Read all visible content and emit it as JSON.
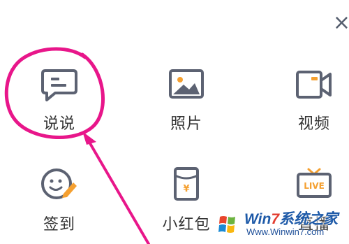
{
  "close_glyph": "×",
  "actions": [
    {
      "label": "说说",
      "icon": "message-icon"
    },
    {
      "label": "照片",
      "icon": "photo-icon"
    },
    {
      "label": "视频",
      "icon": "video-camera-icon"
    },
    {
      "label": "签到",
      "icon": "check-in-face-icon"
    },
    {
      "label": "小红包",
      "icon": "red-packet-icon"
    },
    {
      "label": "直播",
      "icon": "live-tv-icon"
    }
  ],
  "watermark": {
    "title_part1": "Win",
    "title_num": "7",
    "title_part2": "系统之家",
    "url": "Www.Winwin7.com"
  },
  "colors": {
    "icon_gray": "#5c6272",
    "accent_orange": "#f5a030",
    "annotation_magenta": "#e8168a",
    "label_text": "#333333"
  }
}
